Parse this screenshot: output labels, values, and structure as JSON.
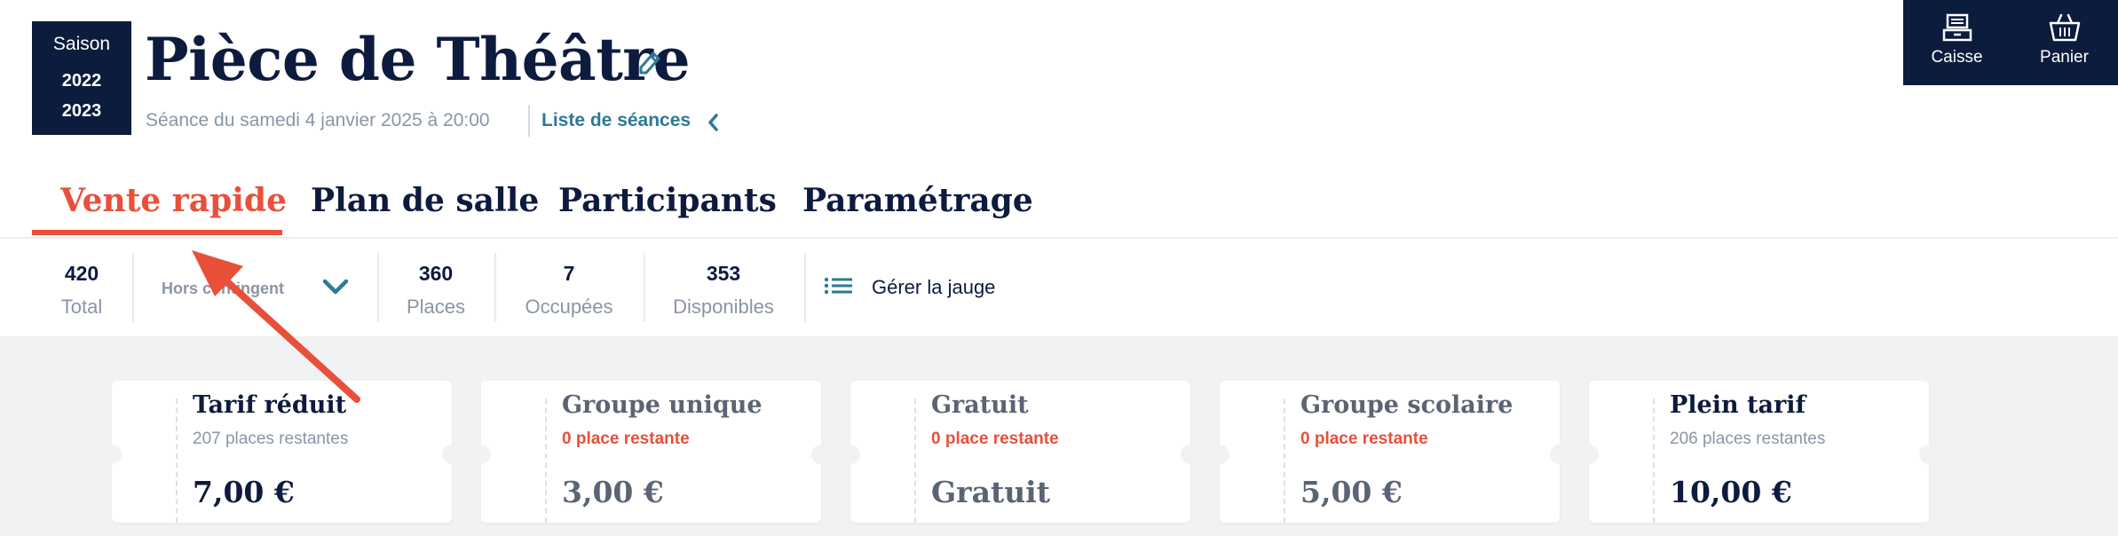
{
  "season": {
    "label": "Saison",
    "year_start": "2022",
    "year_end": "2023"
  },
  "page": {
    "title": "Pièce de Théâtre",
    "subtitle": "Séance du samedi 4 janvier 2025 à 20:00",
    "sessions_link": "Liste de séances"
  },
  "actions": [
    {
      "label": "Caisse",
      "icon": "cash-register-icon"
    },
    {
      "label": "Panier",
      "icon": "basket-icon"
    }
  ],
  "tabs": [
    {
      "label": "Vente rapide",
      "active": true
    },
    {
      "label": "Plan de salle"
    },
    {
      "label": "Participants"
    },
    {
      "label": "Paramétrage"
    }
  ],
  "gauge": {
    "total": {
      "value": "420",
      "label": "Total"
    },
    "contingent": "Hors contingent",
    "places": {
      "value": "360",
      "label": "Places"
    },
    "occupied": {
      "value": "7",
      "label": "Occupées"
    },
    "available": {
      "value": "353",
      "label": "Disponibles"
    },
    "manage": "Gérer la jauge"
  },
  "tariffs": [
    {
      "name": "Tarif réduit",
      "remaining": "207 places restantes",
      "price": "7,00 €",
      "sold_out": false
    },
    {
      "name": "Groupe unique",
      "remaining": "0 place restante",
      "price": "3,00 €",
      "sold_out": true
    },
    {
      "name": "Gratuit",
      "remaining": "0 place restante",
      "price": "Gratuit",
      "sold_out": true
    },
    {
      "name": "Groupe scolaire",
      "remaining": "0 place restante",
      "price": "5,00 €",
      "sold_out": true
    },
    {
      "name": "Plein tarif",
      "remaining": "206 places restantes",
      "price": "10,00 €",
      "sold_out": false
    }
  ],
  "colors": {
    "navy": "#0c1c3d",
    "accent": "#e8503a",
    "link": "#2d7a96",
    "muted": "#8b95a5"
  }
}
